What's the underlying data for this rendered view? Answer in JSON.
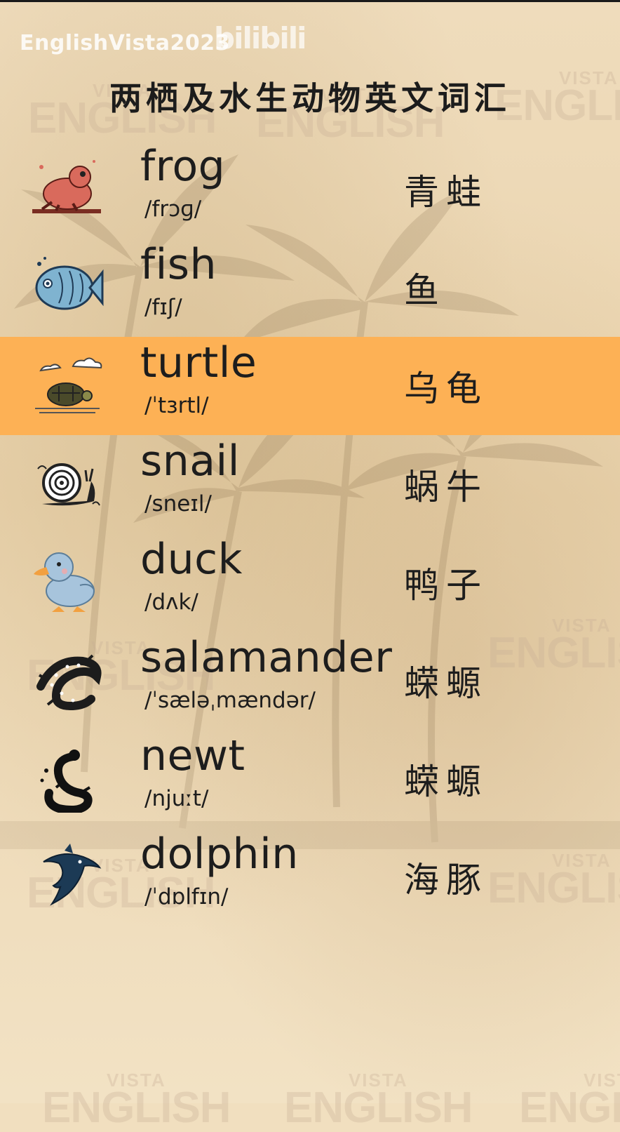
{
  "header": {
    "channel": "EnglishVista2023",
    "platform": "bilibili",
    "title": "两栖及水生动物英文词汇"
  },
  "watermark": {
    "top": "VISTA",
    "bottom": "ENGLISH"
  },
  "accent_color": "#fdb155",
  "vocab": [
    {
      "icon": "frog-icon",
      "word": "frog",
      "ipa": "/frɔɡ/",
      "cn": "青蛙",
      "highlighted": false
    },
    {
      "icon": "fish-icon",
      "word": "fish",
      "ipa": "/fɪʃ/",
      "cn": "鱼",
      "highlighted": false
    },
    {
      "icon": "turtle-icon",
      "word": "turtle",
      "ipa": "/ˈtɜrtl/",
      "cn": "乌龟",
      "highlighted": true
    },
    {
      "icon": "snail-icon",
      "word": "snail",
      "ipa": "/sneɪl/",
      "cn": "蜗牛",
      "highlighted": false
    },
    {
      "icon": "duck-icon",
      "word": "duck",
      "ipa": "/dʌk/",
      "cn": "鸭子",
      "highlighted": false
    },
    {
      "icon": "salamander-icon",
      "word": "salamander",
      "ipa": "/ˈsæləˌmændər/",
      "cn": "蝾螈",
      "highlighted": false
    },
    {
      "icon": "newt-icon",
      "word": "newt",
      "ipa": "/njuːt/",
      "cn": "蝾螈",
      "highlighted": false
    },
    {
      "icon": "dolphin-icon",
      "word": "dolphin",
      "ipa": "/ˈdɒlfɪn/",
      "cn": "海豚",
      "highlighted": false
    }
  ]
}
